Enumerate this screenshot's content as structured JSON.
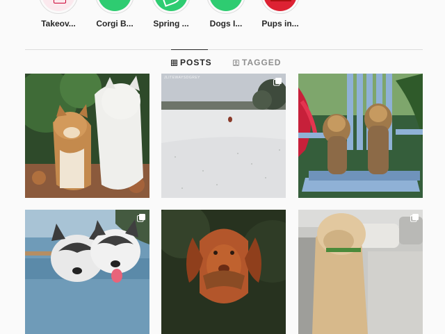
{
  "highlights": [
    {
      "label": "Takeov...",
      "icon": "takeover-highlight"
    },
    {
      "label": "Corgi B...",
      "icon": "corgi-highlight"
    },
    {
      "label": "Spring ...",
      "icon": "spring-highlight"
    },
    {
      "label": "Dogs I...",
      "icon": "dogs-highlight"
    },
    {
      "label": "Pups in...",
      "icon": "pups-highlight"
    }
  ],
  "tabs": [
    {
      "label": "POSTS",
      "icon": "grid-icon",
      "active": true
    },
    {
      "label": "TAGGED",
      "icon": "tag-icon",
      "active": false
    }
  ],
  "posts": [
    {
      "subject": "shiba-and-white-dog",
      "multi": false
    },
    {
      "subject": "snowy-field-dog",
      "multi": true,
      "caption": "JLITEWAYSDGREY"
    },
    {
      "subject": "yorkies-on-chair",
      "multi": false
    },
    {
      "subject": "husky-selfie",
      "multi": true
    },
    {
      "subject": "vizsla-with-toy",
      "multi": false
    },
    {
      "subject": "golden-in-car",
      "multi": true
    }
  ],
  "colors": {
    "accent": "#262626",
    "muted": "#8e8e8e",
    "border": "#dbdbdb",
    "highlight_green": "#2ecc71"
  }
}
